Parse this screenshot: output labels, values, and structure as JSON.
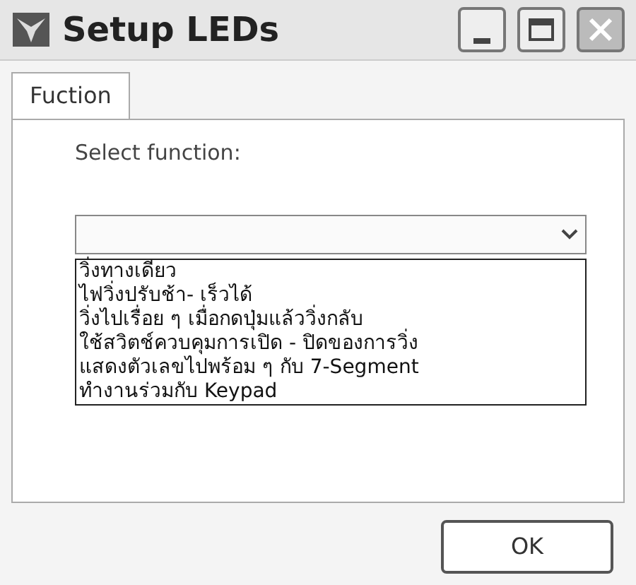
{
  "window": {
    "title": "Setup LEDs"
  },
  "tabs": [
    {
      "label": "Fuction",
      "selected": true
    }
  ],
  "function_label": "Select function:",
  "dropdown": {
    "expanded": true,
    "options": [
      {
        "label": "วิ่งทางเดียว"
      },
      {
        "label": "ไฟวิ่งปรับช้า- เร็วได้"
      },
      {
        "label": "วิ่งไปเรื่อย ๆ เมื่อกดปุ่มแล้ววิ่งกลับ"
      },
      {
        "label": "ใช้สวิตช์ควบคุมการเปิด - ปิดของการวิ่ง"
      },
      {
        "label": "แสดงตัวเลขไปพร้อม ๆ กับ 7-Segment"
      },
      {
        "label": "ทำงานร่วมกับ Keypad"
      }
    ]
  },
  "buttons": [
    {
      "label": "OK"
    }
  ]
}
